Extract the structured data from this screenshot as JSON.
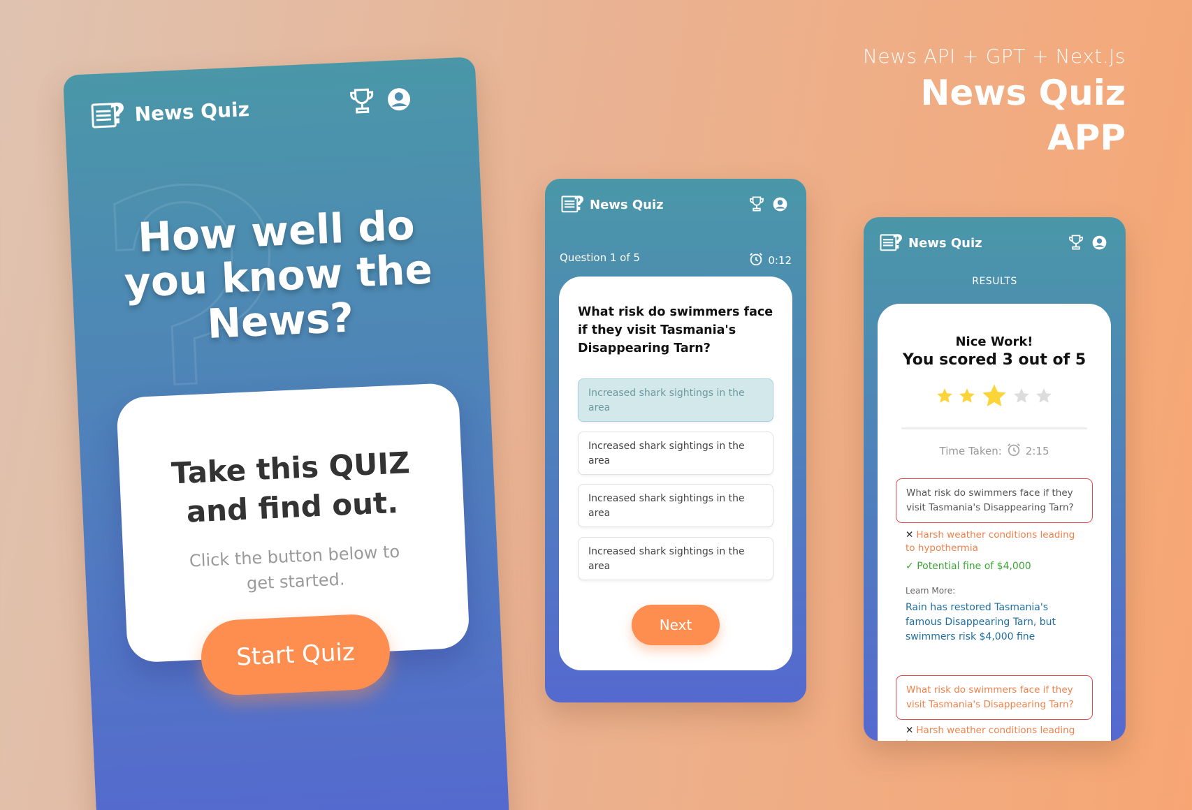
{
  "header": {
    "subtitle": "News API + GPT + Next.Js",
    "title_line1": "News Quiz",
    "title_line2": "APP"
  },
  "app": {
    "name": "News Quiz"
  },
  "landing": {
    "headline_line1": "How well do",
    "headline_line2": "you know the",
    "headline_line3": "News?",
    "card_title_line1": "Take this QUIZ",
    "card_title_line2": "and find out.",
    "card_sub_line1": "Click the button below to",
    "card_sub_line2": "get started.",
    "start_label": "Start Quiz"
  },
  "quiz": {
    "question_counter": "Question  1 of 5",
    "timer": "0:12",
    "question": "What risk do swimmers face if they visit Tasmania's Disappearing Tarn?",
    "options": [
      "Increased shark sightings in the area",
      "Increased shark sightings in the area",
      "Increased shark sightings in the area",
      "Increased shark sightings in the area"
    ],
    "selected_index": 0,
    "next_label": "Next"
  },
  "results": {
    "heading": "RESULTS",
    "nice": "Nice Work!",
    "score": "You scored 3 out of 5",
    "stars_filled": 3,
    "stars_total": 5,
    "time_label": "Time Taken:",
    "time_value": "2:15",
    "items": [
      {
        "question": "What risk do swimmers face if they visit Tasmania's Disappearing Tarn?",
        "wrong": "Harsh weather conditions leading to hypothermia",
        "right": "Potential fine of $4,000",
        "learn_label": "Learn More:",
        "learn_link": "Rain has restored Tasmania's famous Disappearing Tarn, but swimmers risk $4,000 fine"
      },
      {
        "question": "What risk do swimmers face if they visit Tasmania's Disappearing Tarn?",
        "wrong": "Harsh weather conditions leading to"
      }
    ]
  },
  "colors": {
    "accent": "#fd8e4f",
    "gradient_top": "#4a97a8",
    "gradient_bottom": "#5569cf",
    "star": "#fbd43a",
    "star_empty": "#dcdcdc"
  },
  "icons": [
    "news-quiz-logo-icon",
    "trophy-icon",
    "user-icon",
    "alarm-clock-icon",
    "star-icon",
    "x-icon",
    "check-icon"
  ]
}
